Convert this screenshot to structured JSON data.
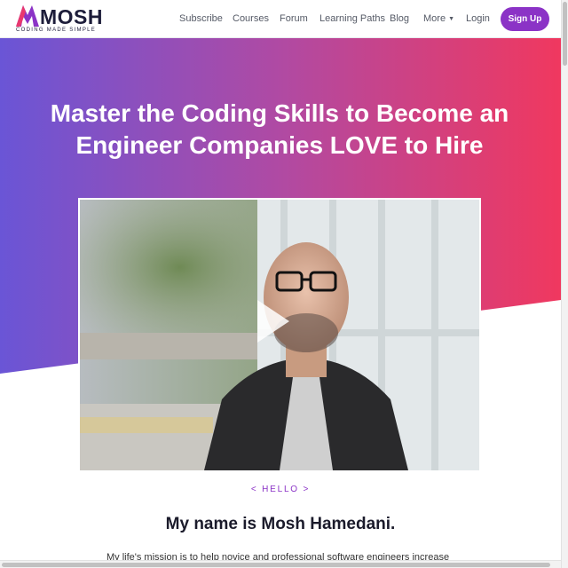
{
  "brand": {
    "name": "MOSH",
    "tagline": "CODING MADE SIMPLE",
    "colors": {
      "primary": "#8b33c6",
      "gradient_start": "#6a55d6",
      "gradient_end": "#f0385f"
    }
  },
  "nav": {
    "links": [
      "Subscribe",
      "Courses",
      "Forum",
      "Learning Paths",
      "Blog",
      "More",
      "Login"
    ],
    "more_icon": "caret-down-icon",
    "signup_label": "Sign Up"
  },
  "hero": {
    "title_line1": "Master the Coding Skills to Become an",
    "title_line2": "Engineer Companies LOVE to Hire",
    "video": {
      "play_icon": "play-icon"
    }
  },
  "intro": {
    "eyebrow": "< HELLO >",
    "heading": "My name is Mosh Hamedani.",
    "mission": "My life's mission is to help novice and professional software engineers increase"
  }
}
